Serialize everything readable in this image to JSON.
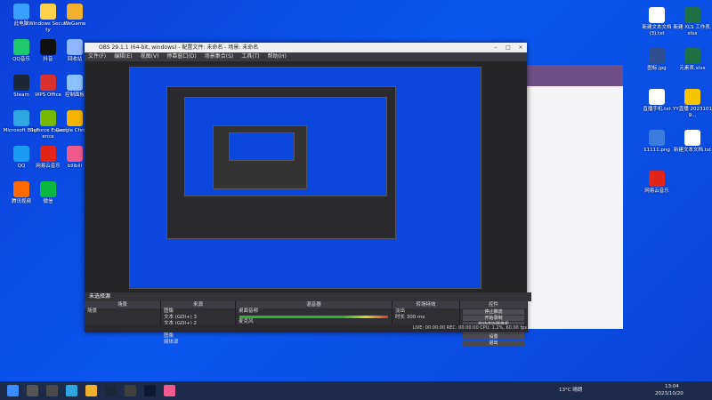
{
  "desktop_icons_left": [
    {
      "label": "此电脑",
      "color": "#3aa0ff"
    },
    {
      "label": "Windows Security",
      "color": "#ffd24a"
    },
    {
      "label": "WeGame",
      "color": "#f2b12d"
    },
    {
      "label": "QQ音乐",
      "color": "#1ec96b"
    },
    {
      "label": "抖音",
      "color": "#111111"
    },
    {
      "label": "回收站",
      "color": "#8fb7ff"
    },
    {
      "label": "Steam",
      "color": "#1b2838"
    },
    {
      "label": "WPS Office",
      "color": "#d8322f"
    },
    {
      "label": "控制面板",
      "color": "#8cc1ff"
    },
    {
      "label": "Microsoft Edge",
      "color": "#2ea7e0"
    },
    {
      "label": "GeForce Experience",
      "color": "#76b900"
    },
    {
      "label": "Google Chrome",
      "color": "#f4b400"
    },
    {
      "label": "QQ",
      "color": "#1a9cf3"
    },
    {
      "label": "网易云音乐",
      "color": "#e1251b"
    },
    {
      "label": "bilibili",
      "color": "#f15a8d"
    },
    {
      "label": "腾讯视频",
      "color": "#ff6a00"
    },
    {
      "label": "微信",
      "color": "#09b83e"
    }
  ],
  "desktop_icons_right": [
    {
      "label": "新建文本文档 (3).txt",
      "color": "#ffffff"
    },
    {
      "label": "新建 XLS 工作表.xlsx",
      "color": "#1e7145"
    },
    {
      "label": "图标.jpg",
      "color": "#2f4f90"
    },
    {
      "label": "元素表.xlsx",
      "color": "#1e7145"
    },
    {
      "label": "直播手机.txt",
      "color": "#ffffff"
    },
    {
      "label": "YY直播 20231019...",
      "color": "#f6c400"
    },
    {
      "label": "11111.png",
      "color": "#3a7dde"
    },
    {
      "label": "新建文本文档.txt",
      "color": "#ffffff"
    },
    {
      "label": "网易云音乐",
      "color": "#e1251b"
    }
  ],
  "obs": {
    "title": "OBS 29.1.1 (64-bit, windows) - 配置文件: 未命名 - 场景: 未命名",
    "menu": [
      "文件(F)",
      "编辑(E)",
      "视图(V)",
      "停靠窗口(D)",
      "场景集合(S)",
      "工具(T)",
      "帮助(H)"
    ],
    "scene_label": "未选择源",
    "docks": {
      "scenes": {
        "title": "场景",
        "items": [
          "场景"
        ]
      },
      "sources": {
        "title": "来源",
        "items": [
          "图像",
          "文本 (GDI+) 3",
          "文本 (GDI+) 2",
          "文本 (GDI+)",
          "图像",
          "媒体源"
        ]
      },
      "mixer": {
        "title": "混音器",
        "channels": [
          "桌面音频",
          "麦克风"
        ]
      },
      "transitions": {
        "title": "转场特效",
        "type": "淡出",
        "duration_label": "时长",
        "duration_value": "300 ms"
      },
      "controls": {
        "title": "控件",
        "buttons": [
          "停止推流",
          "开始录制",
          "启动虚拟摄像机",
          "工作室模式",
          "设置",
          "退出"
        ]
      }
    },
    "status": "LIVE: 00:00:00   REC: 00:00:00   CPU: 1.2%, 60.00 fps"
  },
  "taskbar": {
    "weather": "13°C 晴朗",
    "time": "13:04",
    "date": "2023/10/20"
  }
}
